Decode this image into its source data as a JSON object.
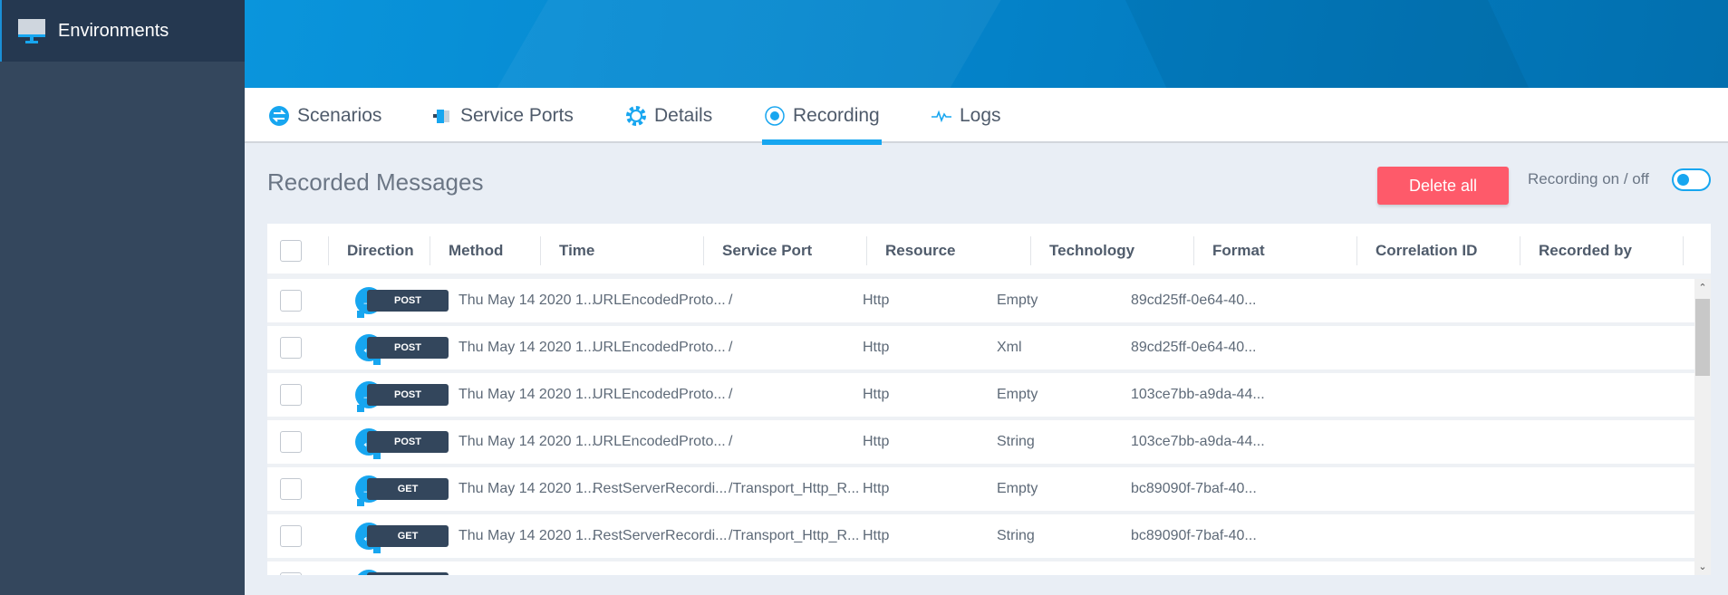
{
  "sidebar": {
    "items": [
      {
        "label": "Environments",
        "icon": "monitor-icon"
      }
    ]
  },
  "tabs": [
    {
      "label": "Scenarios",
      "icon": "swap-arrows-icon",
      "active": false
    },
    {
      "label": "Service Ports",
      "icon": "plug-icon",
      "active": false
    },
    {
      "label": "Details",
      "icon": "gear-icon",
      "active": false
    },
    {
      "label": "Recording",
      "icon": "record-icon",
      "active": true
    },
    {
      "label": "Logs",
      "icon": "pulse-icon",
      "active": false
    }
  ],
  "main": {
    "title": "Recorded Messages",
    "delete_all": "Delete all",
    "recording_toggle_label": "Recording on / off",
    "recording_on": true
  },
  "colors": {
    "accent": "#17a6f0",
    "danger": "#fe5a6a",
    "sidebar": "#34475d"
  },
  "table": {
    "columns": [
      "Direction",
      "Method",
      "Time",
      "Service Port",
      "Resource",
      "Technology",
      "Format",
      "Correlation ID",
      "Recorded by"
    ],
    "rows": [
      {
        "direction": "outgoing",
        "method": "POST",
        "time": "Thu May 14 2020 1...",
        "service_port": "URLEncodedProto...",
        "resource": "/",
        "technology": "Http",
        "format": "Empty",
        "correlation_id": "89cd25ff-0e64-40...",
        "recorded_by": ""
      },
      {
        "direction": "incoming",
        "method": "POST",
        "time": "Thu May 14 2020 1...",
        "service_port": "URLEncodedProto...",
        "resource": "/",
        "technology": "Http",
        "format": "Xml",
        "correlation_id": "89cd25ff-0e64-40...",
        "recorded_by": ""
      },
      {
        "direction": "outgoing",
        "method": "POST",
        "time": "Thu May 14 2020 1...",
        "service_port": "URLEncodedProto...",
        "resource": "/",
        "technology": "Http",
        "format": "Empty",
        "correlation_id": "103ce7bb-a9da-44...",
        "recorded_by": ""
      },
      {
        "direction": "incoming",
        "method": "POST",
        "time": "Thu May 14 2020 1...",
        "service_port": "URLEncodedProto...",
        "resource": "/",
        "technology": "Http",
        "format": "String",
        "correlation_id": "103ce7bb-a9da-44...",
        "recorded_by": ""
      },
      {
        "direction": "outgoing",
        "method": "GET",
        "time": "Thu May 14 2020 1...",
        "service_port": "RestServerRecordi...",
        "resource": "/Transport_Http_R...",
        "technology": "Http",
        "format": "Empty",
        "correlation_id": "bc89090f-7baf-40...",
        "recorded_by": ""
      },
      {
        "direction": "incoming",
        "method": "GET",
        "time": "Thu May 14 2020 1...",
        "service_port": "RestServerRecordi...",
        "resource": "/Transport_Http_R...",
        "technology": "Http",
        "format": "String",
        "correlation_id": "bc89090f-7baf-40...",
        "recorded_by": ""
      },
      {
        "direction": "outgoing",
        "method": "",
        "time": "",
        "service_port": "",
        "resource": "",
        "technology": "",
        "format": "",
        "correlation_id": "",
        "recorded_by": ""
      }
    ]
  }
}
